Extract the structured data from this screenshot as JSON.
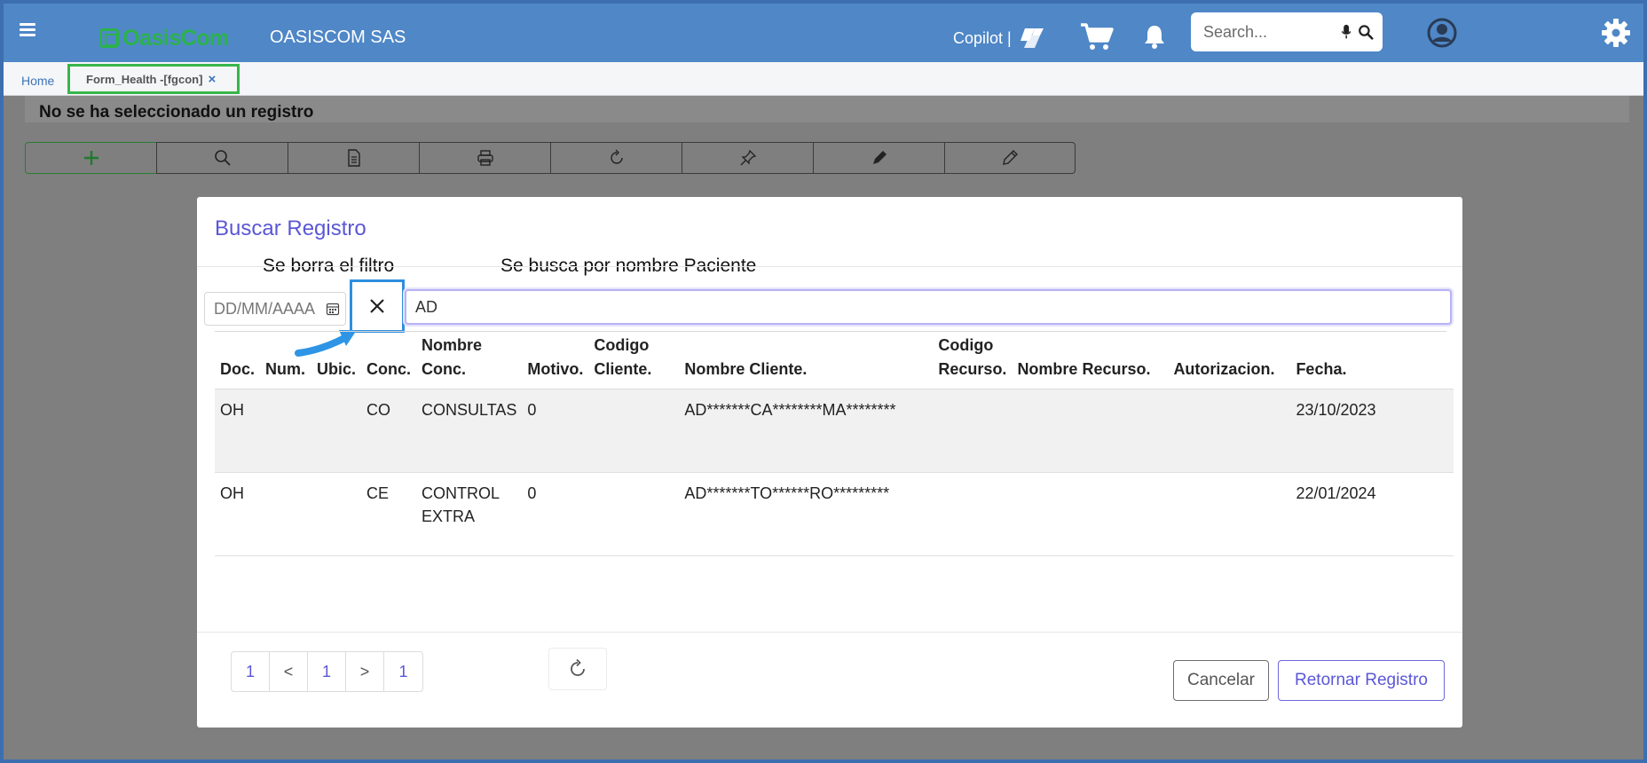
{
  "header": {
    "logo_text": "OasisCom",
    "company": "OASISCOM SAS",
    "copilot_label": "Copilot |",
    "search_placeholder": "Search...",
    "brand_color": "#4f87c7",
    "logo_color": "#2bb24c"
  },
  "tabs": {
    "home": "Home",
    "active": "Form_Health -[fgcon]",
    "close": "×"
  },
  "page": {
    "status": "No se ha seleccionado un registro",
    "toolbar_icons": [
      "plus-icon",
      "search-icon",
      "document-icon",
      "print-icon",
      "refresh-icon",
      "pin-icon",
      "pen-icon",
      "pencil-icon"
    ]
  },
  "modal": {
    "title": "Buscar Registro",
    "annotation_clear": "Se borra el filtro",
    "annotation_search": "Se busca por nombre Paciente",
    "date_placeholder": "DD/MM/AAAA",
    "name_value": "AD",
    "accent_color": "#5b57d6",
    "columns": [
      "Doc.",
      "Num.",
      "Ubic.",
      "Conc.",
      "Nombre Conc.",
      "Motivo.",
      "Codigo Cliente.",
      "Nombre Cliente.",
      "Codigo Recurso.",
      "Nombre Recurso.",
      "Autorizacion.",
      "Fecha."
    ],
    "rows": [
      {
        "doc": "OH",
        "num": "",
        "ubic": "",
        "conc": "CO",
        "nombre_conc": "CONSULTAS",
        "motivo": "0",
        "codigo_cliente": "",
        "nombre_cliente": "AD*******CA********MA********",
        "codigo_recurso": "",
        "nombre_recurso": "",
        "autorizacion": "",
        "fecha": "23/10/2023"
      },
      {
        "doc": "OH",
        "num": "",
        "ubic": "",
        "conc": "CE",
        "nombre_conc": "CONTROL EXTRA",
        "motivo": "0",
        "codigo_cliente": "",
        "nombre_cliente": "AD*******TO******RO*********",
        "codigo_recurso": "",
        "nombre_recurso": "",
        "autorizacion": "",
        "fecha": "22/01/2024"
      }
    ],
    "pager": {
      "first": "1",
      "prev": "<",
      "current": "1",
      "next": ">",
      "last": "1"
    },
    "cancel_label": "Cancelar",
    "return_label": "Retornar Registro"
  }
}
